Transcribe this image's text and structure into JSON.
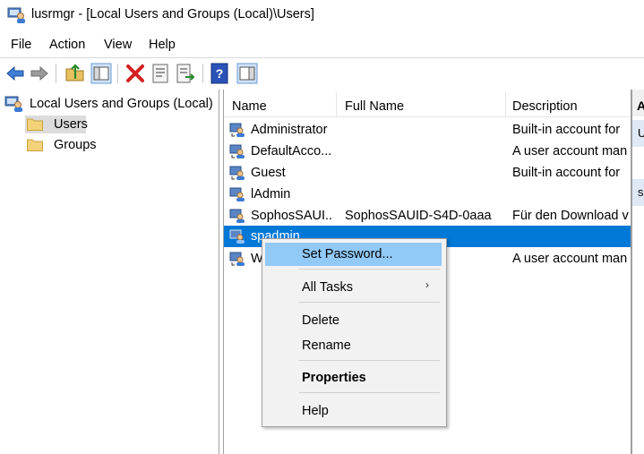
{
  "window": {
    "title": "lusrmgr - [Local Users and Groups (Local)\\Users]"
  },
  "menu": {
    "items": [
      "File",
      "Action",
      "View",
      "Help"
    ]
  },
  "toolbar": {
    "buttons": [
      "back-arrow-icon",
      "forward-arrow-icon",
      "up-folder-icon",
      "show-hide-tree-icon",
      "delete-icon",
      "properties-icon",
      "export-list-icon",
      "help-icon",
      "show-hide-action-pane-icon"
    ]
  },
  "tree": {
    "root": "Local Users and Groups (Local)",
    "children": [
      "Users",
      "Groups"
    ],
    "selected": "Users"
  },
  "list": {
    "columns": [
      "Name",
      "Full Name",
      "Description"
    ],
    "rows": [
      {
        "name": "Administrator",
        "full": "",
        "desc": "Built-in account for"
      },
      {
        "name": "DefaultAcco...",
        "full": "",
        "desc": "A user account man"
      },
      {
        "name": "Guest",
        "full": "",
        "desc": "Built-in account for"
      },
      {
        "name": "lAdmin",
        "full": "",
        "desc": ""
      },
      {
        "name": "SophosSAUI...",
        "full": "SophosSAUID-S4D-0aaa",
        "desc": "Für den Download v"
      },
      {
        "name": "spadmin",
        "full": "",
        "desc": ""
      },
      {
        "name": "W",
        "full": "",
        "desc": "A user account man"
      }
    ],
    "selected_row": 5
  },
  "actions_pane": {
    "header": "A",
    "section1": "U",
    "section2": "s"
  },
  "context_menu": {
    "set_password": "Set Password...",
    "all_tasks": "All Tasks",
    "submenu_arrow": "›",
    "delete": "Delete",
    "rename": "Rename",
    "properties": "Properties",
    "help": "Help"
  },
  "colors": {
    "selection": "#0078d7",
    "menu_hover": "#91c9f7",
    "menu_bg": "#f2f2f2"
  }
}
